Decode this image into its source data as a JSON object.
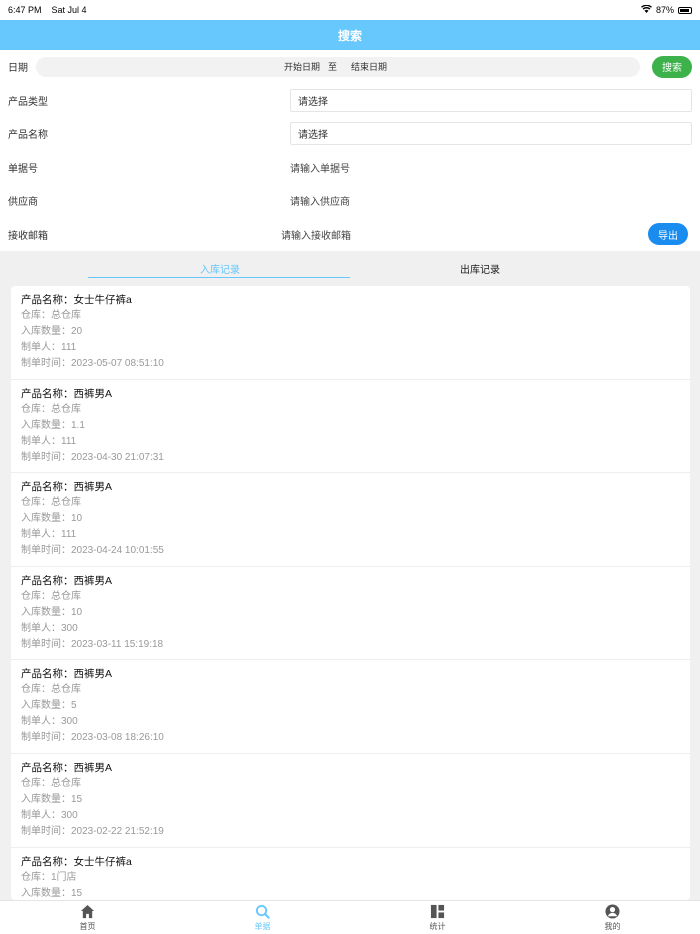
{
  "status": {
    "time": "6:47 PM",
    "date": "Sat Jul 4",
    "battery": "87%"
  },
  "header": {
    "title": "搜索"
  },
  "form": {
    "date_label": "日期",
    "start_date": "开始日期",
    "to": "至",
    "end_date": "结束日期",
    "search_button": "搜索",
    "product_type_label": "产品类型",
    "product_type_value": "请选择",
    "product_name_label": "产品名称",
    "product_name_value": "请选择",
    "doc_no_label": "单据号",
    "doc_no_placeholder": "请输入单据号",
    "supplier_label": "供应商",
    "supplier_placeholder": "请输入供应商",
    "email_label": "接收邮箱",
    "email_placeholder": "请输入接收邮箱",
    "export_button": "导出"
  },
  "tabs": {
    "in": "入库记录",
    "out": "出库记录"
  },
  "records": [
    {
      "title": "产品名称：女士牛仔裤a",
      "warehouse": "仓库：总仓库",
      "qty": "入库数量：20",
      "maker": "制单人：111",
      "time": "制单时间：2023-05-07 08:51:10"
    },
    {
      "title": "产品名称：西裤男A",
      "warehouse": "仓库：总仓库",
      "qty": "入库数量：1.1",
      "maker": "制单人：111",
      "time": "制单时间：2023-04-30 21:07:31"
    },
    {
      "title": "产品名称：西裤男A",
      "warehouse": "仓库：总仓库",
      "qty": "入库数量：10",
      "maker": "制单人：111",
      "time": "制单时间：2023-04-24 10:01:55"
    },
    {
      "title": "产品名称：西裤男A",
      "warehouse": "仓库：总仓库",
      "qty": "入库数量：10",
      "maker": "制单人：300",
      "time": "制单时间：2023-03-11 15:19:18"
    },
    {
      "title": "产品名称：西裤男A",
      "warehouse": "仓库：总仓库",
      "qty": "入库数量：5",
      "maker": "制单人：300",
      "time": "制单时间：2023-03-08 18:26:10"
    },
    {
      "title": "产品名称：西裤男A",
      "warehouse": "仓库：总仓库",
      "qty": "入库数量：15",
      "maker": "制单人：300",
      "time": "制单时间：2023-02-22 21:52:19"
    },
    {
      "title": "产品名称：女士牛仔裤a",
      "warehouse": "仓库：1门店",
      "qty": "入库数量：15",
      "maker": "",
      "time": ""
    }
  ],
  "tabbar": {
    "home": "首页",
    "docs": "单据",
    "stats": "统计",
    "mine": "我的"
  }
}
